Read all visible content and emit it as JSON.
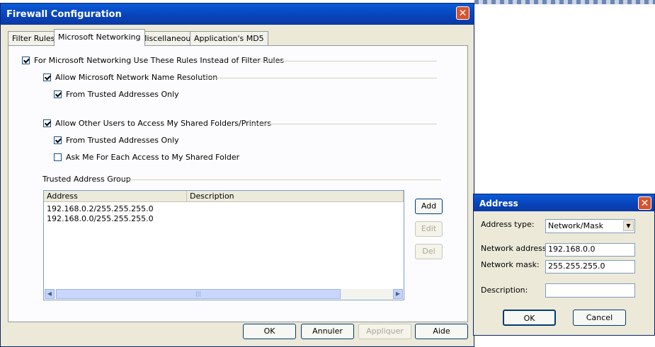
{
  "firewall": {
    "title": "Firewall Configuration",
    "tabs": [
      "Filter Rules",
      "Microsoft Networking",
      "Miscellaneous",
      "Application's MD5"
    ],
    "options": {
      "use_rules": {
        "label": "For Microsoft Networking Use These Rules Instead of Filter Rules",
        "checked": true
      },
      "name_resolution": {
        "label": "Allow Microsoft Network Name Resolution",
        "checked": true
      },
      "name_trusted_only": {
        "label": "From Trusted Addresses Only",
        "checked": true
      },
      "allow_shared": {
        "label": "Allow Other Users to Access My Shared Folders/Printers",
        "checked": true
      },
      "shared_trusted_only": {
        "label": "From Trusted Addresses Only",
        "checked": true
      },
      "ask_each_access": {
        "label": "Ask Me For Each Access to My Shared Folder",
        "checked": false
      }
    },
    "group_label": "Trusted Address Group",
    "columns": [
      "Address",
      "Description"
    ],
    "rows": [
      {
        "address": "192.168.0.2/255.255.255.0",
        "description": ""
      },
      {
        "address": "192.168.0.0/255.255.255.0",
        "description": ""
      }
    ],
    "side_buttons": {
      "add": "Add",
      "edit": "Edit",
      "del": "Del"
    },
    "footer_buttons": {
      "ok": "OK",
      "cancel": "Annuler",
      "apply": "Appliquer",
      "help": "Aide"
    }
  },
  "address_dialog": {
    "title": "Address",
    "type_label": "Address type:",
    "type_value": "Network/Mask",
    "network_label": "Network address:",
    "network_value": "192.168.0.0",
    "mask_label": "Network mask:",
    "mask_value": "255.255.255.0",
    "description_label": "Description:",
    "description_value": "",
    "ok": "OK",
    "cancel": "Cancel"
  },
  "icons": {
    "close": "close-icon",
    "dropdown": "chevron-down-icon"
  },
  "colors": {
    "titlebar": "#0a4fcf",
    "dialog_bg": "#ece9d8",
    "close": "#d9522c"
  }
}
